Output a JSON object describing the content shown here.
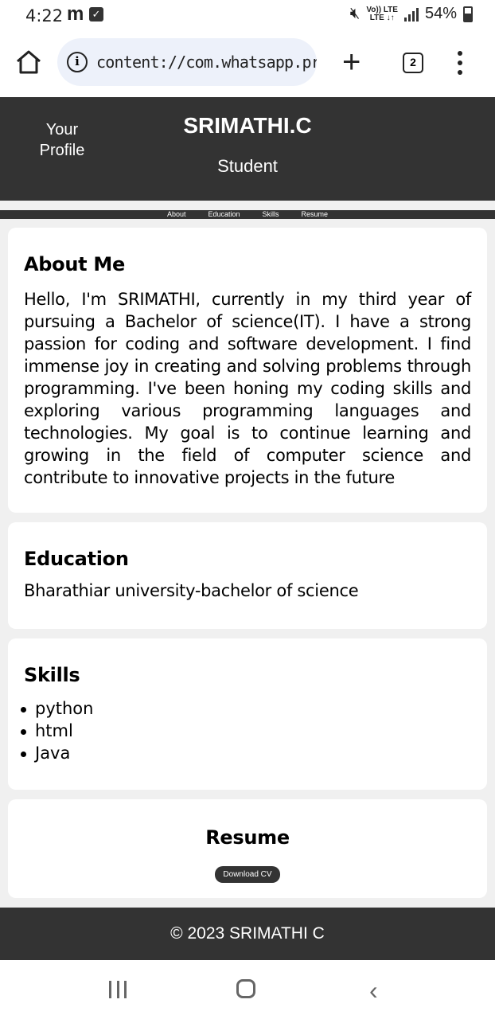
{
  "status_bar": {
    "time": "4:22",
    "notif_letter": "m",
    "volte": [
      "Vo)) LTE",
      "LTE ↓↑"
    ],
    "battery": "54%"
  },
  "browser": {
    "url": "content://com.whatsapp.pr",
    "tab_count": "2"
  },
  "header": {
    "profile_alt": "Your Profile",
    "name": "SRIMATHI.C",
    "role": "Student"
  },
  "nav": [
    "About",
    "Education",
    "Skills",
    "Resume"
  ],
  "about": {
    "title": "About Me",
    "text": "Hello, I'm SRIMATHI, currently in my third year of pursuing a Bachelor of science(IT). I have a strong passion for coding and software development. I find immense joy in creating and solving problems through programming. I've been honing my coding skills and exploring various programming languages and technologies. My goal is to continue learning and growing in the field of computer science and contribute to innovative projects in the future"
  },
  "education": {
    "title": "Education",
    "text": "Bharathiar university-bachelor of science"
  },
  "skills": {
    "title": "Skills",
    "items": [
      "python",
      "html",
      "Java"
    ]
  },
  "resume": {
    "title": "Resume",
    "button": "Download CV"
  },
  "footer": {
    "text": "© 2023 SRIMATHI C"
  }
}
